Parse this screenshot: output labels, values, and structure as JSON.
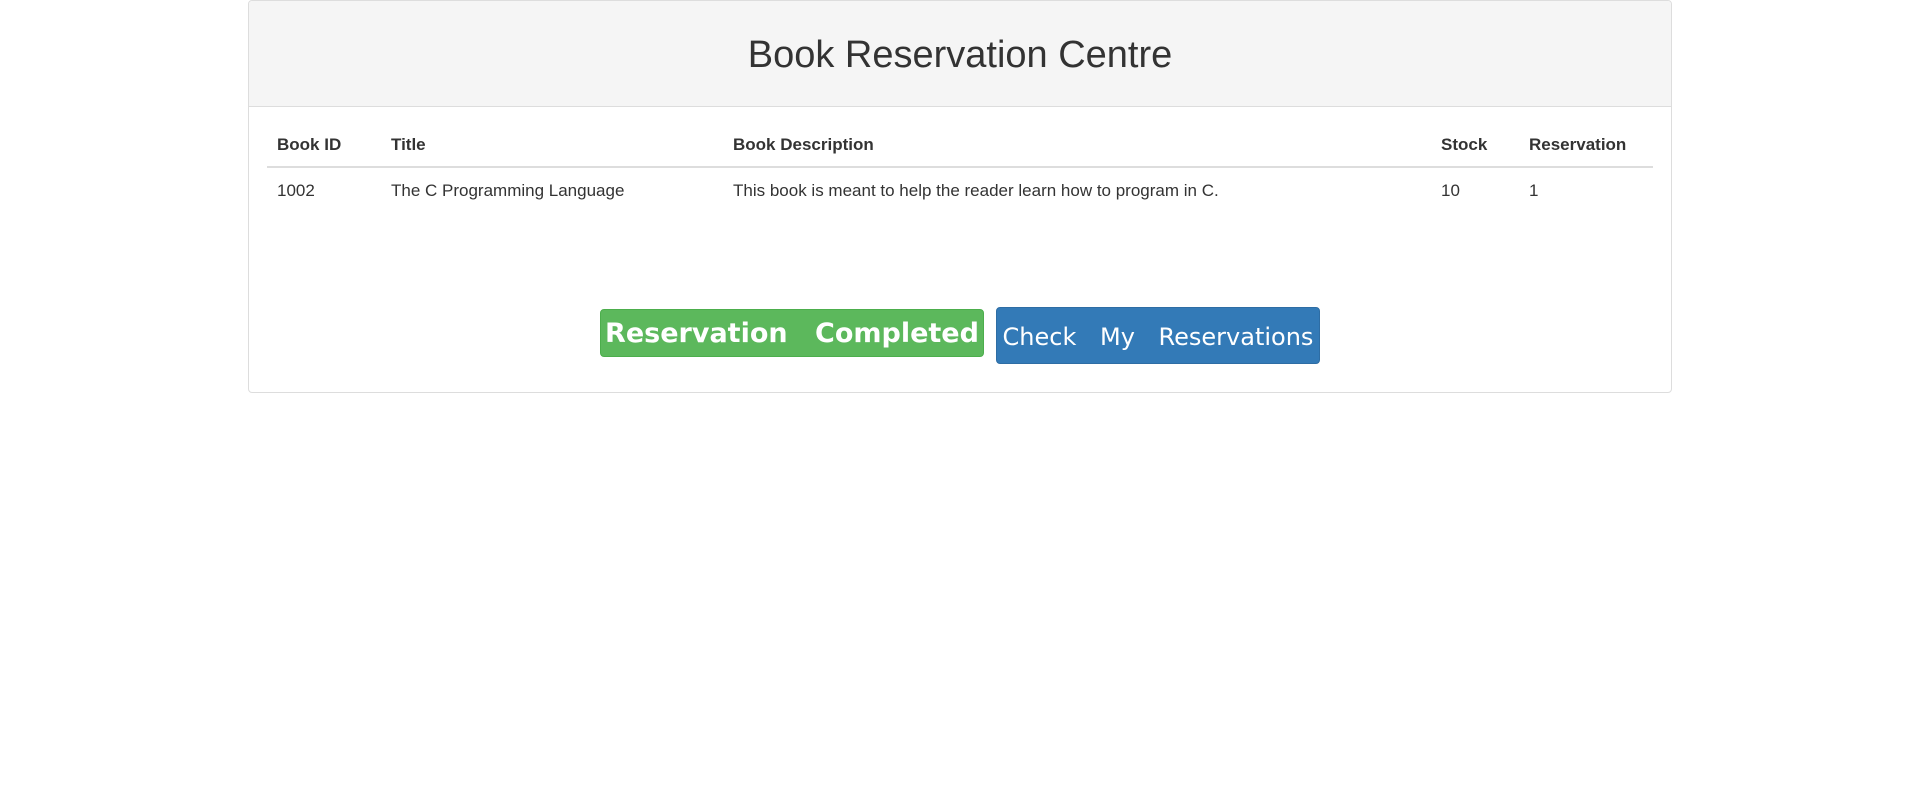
{
  "page": {
    "title": "Book Reservation Centre"
  },
  "table": {
    "headers": {
      "book_id": "Book ID",
      "title": "Title",
      "description": "Book Description",
      "stock": "Stock",
      "reservation": "Reservation"
    },
    "rows": [
      {
        "book_id": "1002",
        "title": "The C Programming Language",
        "description": "This book is meant to help the reader learn how to program in C.",
        "stock": "10",
        "reservation": "1"
      }
    ]
  },
  "actions": {
    "status_label": "Reservation Completed",
    "check_label": "Check My Reservations"
  },
  "colors": {
    "success": "#5cb85c",
    "primary": "#337ab7",
    "heading_bg": "#f5f5f5"
  }
}
